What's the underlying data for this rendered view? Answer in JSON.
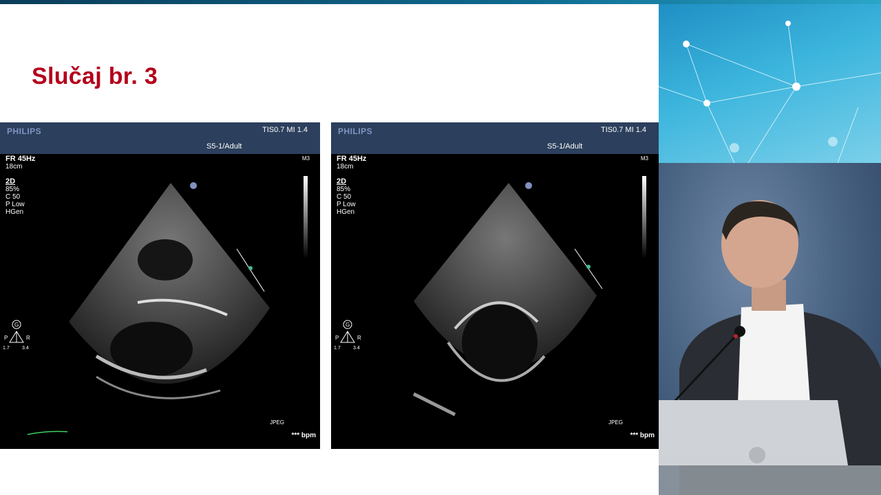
{
  "slide": {
    "title": "Slučaj br. 3"
  },
  "panels": [
    {
      "brand": "PHILIPS",
      "tis_mi": "TIS0.7   MI 1.4",
      "probe": "S5-1/Adult",
      "fr": "FR 45Hz",
      "depth": "18cm",
      "mode": "2D",
      "gain": "85%",
      "compress": "C 50",
      "power": "P Low",
      "freq": "HGen",
      "m3": "M3",
      "jpeg": "JPEG",
      "bpm": "*** bpm",
      "orient": {
        "g": "G",
        "p": "P",
        "r": "R",
        "v1": "1.7",
        "v2": "3.4"
      }
    },
    {
      "brand": "PHILIPS",
      "tis_mi": "TIS0.7   MI 1.4",
      "probe": "S5-1/Adult",
      "fr": "FR 45Hz",
      "depth": "18cm",
      "mode": "2D",
      "gain": "85%",
      "compress": "C 50",
      "power": "P Low",
      "freq": "HGen",
      "m3": "M3",
      "jpeg": "JPEG",
      "bpm": "*** bpm",
      "orient": {
        "g": "G",
        "p": "P",
        "r": "R",
        "v1": "1.7",
        "v2": "3.4"
      }
    }
  ],
  "colors": {
    "title": "#b3001b",
    "header_bar": "#2c3f5c",
    "brand_text": "#7f96c4"
  }
}
